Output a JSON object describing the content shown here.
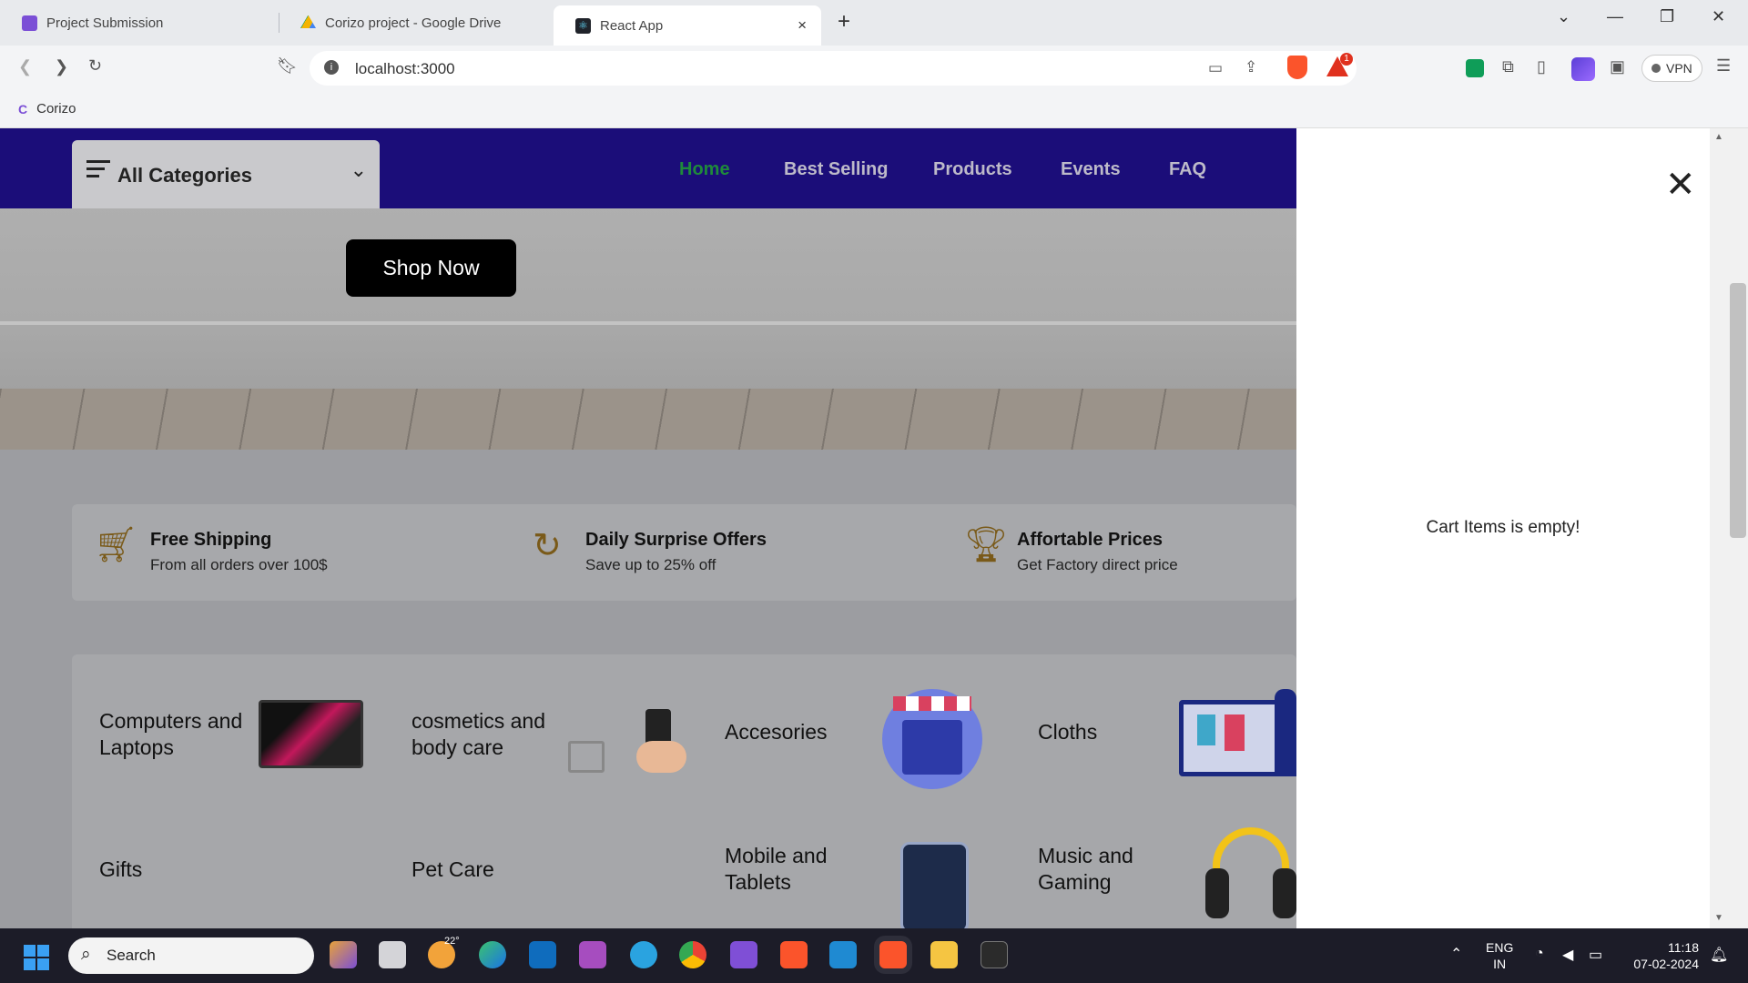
{
  "browser": {
    "tabs": [
      {
        "title": "Project Submission",
        "color": "#7b4fd6"
      },
      {
        "title": "Corizo project - Google Drive",
        "color": "#f4b400"
      },
      {
        "title": "React App",
        "color": "#20232a"
      }
    ],
    "new_tab_label": "+",
    "close_tab_glyph": "×",
    "url": "localhost:3000",
    "bookmark": "Corizo",
    "vpn_label": "VPN",
    "notification_count": "1"
  },
  "header": {
    "all_categories": "All Categories",
    "menu": [
      "Home",
      "Best Selling",
      "Products",
      "Events",
      "FAQ"
    ],
    "bg_color": "#1b0d79",
    "active_color": "#1f8a3b"
  },
  "hero": {
    "shop_now": "Shop Now"
  },
  "features": [
    {
      "title": "Free Shipping",
      "subtitle": "From all orders over 100$",
      "icon": "cart-icon"
    },
    {
      "title": "Daily Surprise Offers",
      "subtitle": "Save up to 25% off",
      "icon": "refresh-icon"
    },
    {
      "title": "Affortable Prices",
      "subtitle": "Get Factory direct price",
      "icon": "trophy-icon"
    }
  ],
  "categories": [
    {
      "label": "Computers and Laptops"
    },
    {
      "label": "cosmetics and body care"
    },
    {
      "label": "Accesories"
    },
    {
      "label": "Cloths"
    },
    {
      "label": "Gifts"
    },
    {
      "label": "Pet Care"
    },
    {
      "label": "Mobile and Tablets"
    },
    {
      "label": "Music and Gaming"
    }
  ],
  "cart": {
    "empty_message": "Cart Items is empty!",
    "close_glyph": "✕"
  },
  "taskbar": {
    "search": "Search",
    "weather": "22°",
    "lang_1": "ENG",
    "lang_2": "IN",
    "time": "11:18",
    "date": "07-02-2024"
  }
}
